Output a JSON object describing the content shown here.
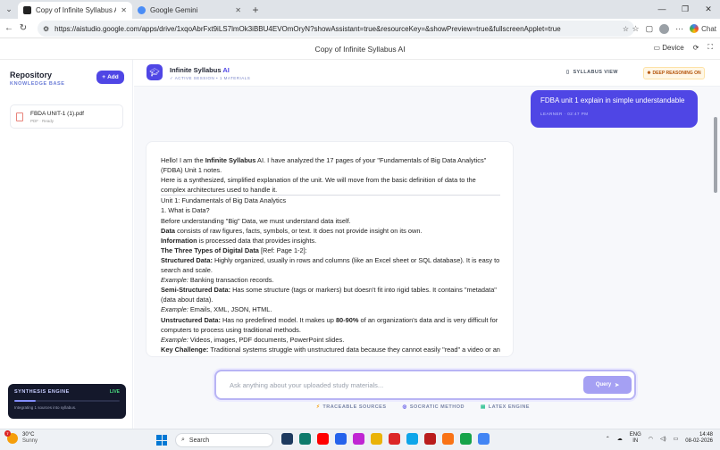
{
  "browser": {
    "tabs": [
      {
        "title": "Copy of Infinite Syllabus AI | Goog"
      },
      {
        "title": "Google Gemini"
      }
    ],
    "url": "https://aistudio.google.com/apps/drive/1xqoAbrFxt9iLS7lmOk3iBBU4EVOmOryN?showAssistant=true&resourceKey=&showPreview=true&fullscreenApplet=true",
    "chat_label": "Chat"
  },
  "appbar": {
    "title": "Copy of Infinite Syllabus AI",
    "device_label": "Device"
  },
  "sidebar": {
    "title": "Repository",
    "subtitle": "KNOWLEDGE BASE",
    "add_label": "Add",
    "file": {
      "name": "FBDA UNIT-1 (1).pdf",
      "meta": "PDF · Ready"
    },
    "engine": {
      "title": "SYNTHESIS ENGINE",
      "status": "LIVE",
      "progress": 0.2,
      "text": "Integrating 1 sources into syllabus."
    }
  },
  "header": {
    "title_main": "Infinite Syllabus",
    "title_ai": "AI",
    "subtitle": "✓ ACTIVE SESSION • 1 MATERIALS",
    "syllabus_view": "SYLLABUS VIEW",
    "deep_reasoning": "DEEP REASONING ON"
  },
  "user_message": {
    "text": "FDBA unit 1 explain in simple understandable",
    "meta": "LEARNER · 02:47 PM"
  },
  "answer": {
    "l1a": "Hello! I am the ",
    "l1b": "Infinite Syllabus",
    "l1c": " AI. I have analyzed the 17 pages of your \"Fundamentals of Big Data Analytics\" (FDBA) Unit 1 notes.",
    "l2": "Here is a synthesized, simplified explanation of the unit. We will move from the basic definition of data to the complex architectures used to handle it.",
    "l3": "Unit 1: Fundamentals of Big Data Analytics",
    "l4": "1. What is Data?",
    "l5": "Before understanding \"Big\" Data, we must understand data itself.",
    "l6a": "Data",
    "l6b": " consists of raw figures, facts, symbols, or text. It does not provide insight on its own.",
    "l7a": "Information",
    "l7b": " is processed data that provides insights.",
    "l8a": "The Three Types of Digital Data",
    "l8b": " [Ref: Page 1-2]:",
    "l9a": "Structured Data:",
    "l9b": " Highly organized, usually in rows and columns (like an Excel sheet or SQL database). It is easy to search and scale.",
    "l10a": "Example:",
    "l10b": " Banking transaction records.",
    "l11a": "Semi-Structured Data:",
    "l11b": " Has some structure (tags or markers) but doesn't fit into rigid tables. It contains \"metadata\" (data about data).",
    "l12a": "Example:",
    "l12b": " Emails, XML, JSON, HTML.",
    "l13a": "Unstructured Data:",
    "l13b": " Has no predefined model. It makes up ",
    "l13c": "80-90%",
    "l13d": " of an organization's data and is very difficult for computers to process using traditional methods.",
    "l14a": "Example:",
    "l14b": " Videos, images, PDF documents, PowerPoint slides.",
    "l15a": "Key Challenge:",
    "l15b": " Traditional systems struggle with unstructured data because they cannot easily \"read\" a video or an image to extract meaning without advanced tools like Natural Language Processing (NLP) or Text Analytics [Ref: Page"
  },
  "composer": {
    "placeholder": "Ask anything about your uploaded study materials...",
    "query_label": "Query"
  },
  "chips": [
    "TRACEABLE SOURCES",
    "SOCRATIC METHOD",
    "LATEX ENGINE"
  ],
  "taskbar": {
    "weather_temp": "30°C",
    "weather_desc": "Sunny",
    "weather_badge": "7",
    "search_label": "Search",
    "lang1": "ENG",
    "lang2": "IN",
    "time": "14:48",
    "date": "08-02-2026"
  },
  "colors": {
    "accent": "#4f46e5",
    "engine_bg": "#14182b",
    "live": "#4ade80"
  }
}
